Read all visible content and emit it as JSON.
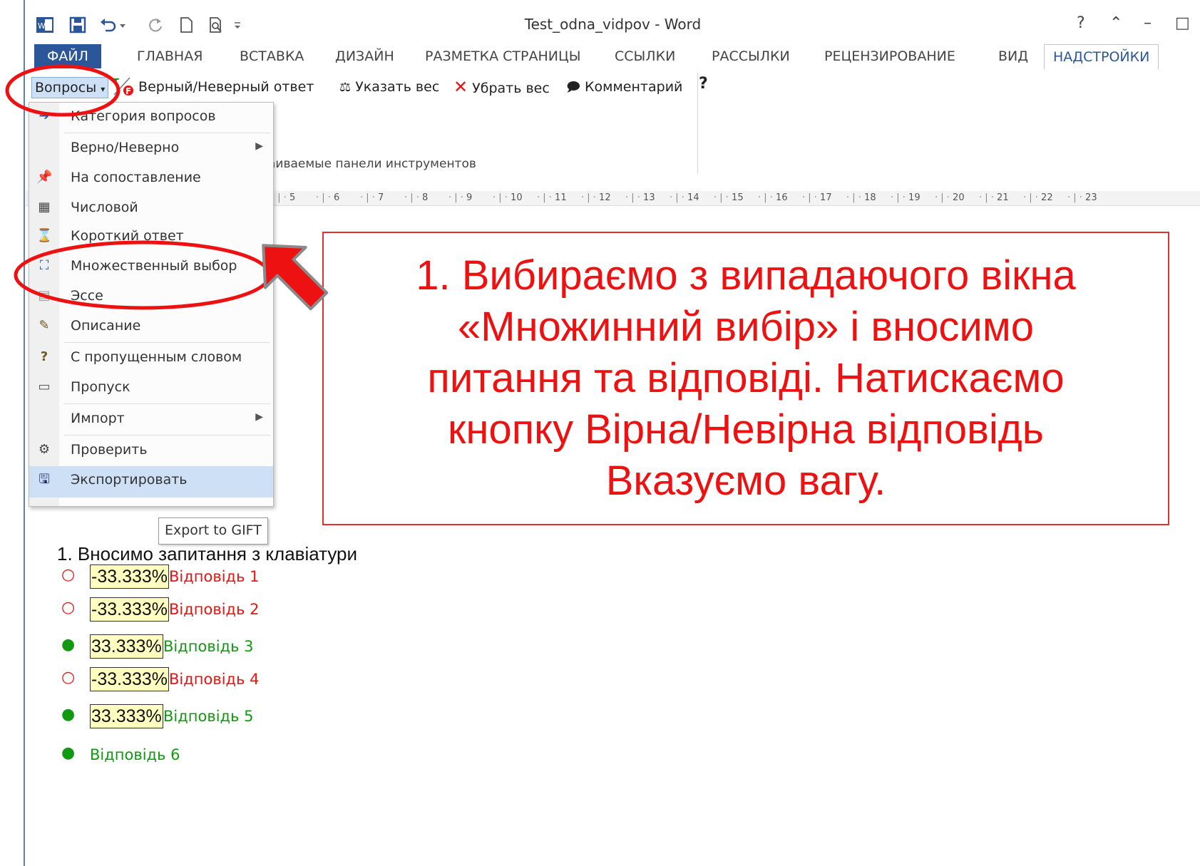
{
  "app": {
    "title": "Test_odna_vidpov - Word",
    "window_controls": [
      "?",
      "⌃",
      "–",
      "□"
    ]
  },
  "tabs": [
    {
      "label": "ФАЙЛ"
    },
    {
      "label": "ГЛАВНАЯ"
    },
    {
      "label": "ВСТАВКА"
    },
    {
      "label": "ДИЗАЙН"
    },
    {
      "label": "РАЗМЕТКА СТРАНИЦЫ"
    },
    {
      "label": "ССЫЛКИ"
    },
    {
      "label": "РАССЫЛКИ"
    },
    {
      "label": "РЕЦЕНЗИРОВАНИЕ"
    },
    {
      "label": "ВИД"
    },
    {
      "label": "НАДСТРОЙКИ"
    }
  ],
  "ribbon": {
    "questions_label": "Вопросы",
    "true_false_label": "Верный/Неверный ответ",
    "set_weight_label": "Указать вес",
    "remove_weight_label": "Убрать вес",
    "comment_label": "Комментарий",
    "help_glyph": "?",
    "group_label": "аиваемые панели инструментов"
  },
  "ruler": {
    "marks": [
      "5",
      "6",
      "7",
      "8",
      "9",
      "10",
      "11",
      "12",
      "13",
      "14",
      "15",
      "16",
      "17",
      "18",
      "19",
      "20",
      "21",
      "22",
      "23"
    ]
  },
  "dropdown": {
    "items": [
      {
        "label": "Категория вопросов"
      },
      {
        "label": "Верно/Неверно"
      },
      {
        "label": "На сопоставление"
      },
      {
        "label": "Числовой"
      },
      {
        "label": "Короткий ответ"
      },
      {
        "label": "Множественный выбор"
      },
      {
        "label": "Эссе"
      },
      {
        "label": "Описание"
      },
      {
        "label": "С пропущенным словом"
      },
      {
        "label": "Пропуск"
      },
      {
        "label": "Импорт"
      },
      {
        "label": "Проверить"
      },
      {
        "label": "Экспортировать"
      }
    ]
  },
  "tooltip": {
    "text": "Export to GIFT"
  },
  "callout": {
    "text": "1. Вибираємо  з випадаючого вікна\n«Множинний вибір» і вносимо\nпитання та відповіді. Натискаємо\nкнопку Вірна/Невірна відповідь\nВказуємо вагу."
  },
  "document": {
    "question": "1.  Вносимо запитання з клавіатури",
    "answers": [
      {
        "weight": "-33.333%",
        "text": "Відповідь 1",
        "correct": false
      },
      {
        "weight": "-33.333%",
        "text": "Відповідь 2",
        "correct": false
      },
      {
        "weight": "33.333%",
        "text": "Відповідь 3",
        "correct": true
      },
      {
        "weight": "-33.333%",
        "text": "Відповідь 4",
        "correct": false
      },
      {
        "weight": "33.333%",
        "text": "Відповідь 5",
        "correct": true
      },
      {
        "weight": "",
        "text": "Відповідь 6",
        "correct": true
      }
    ]
  },
  "colors": {
    "accent": "#2b579a",
    "highlight_red": "#e11",
    "correct_green": "#119911"
  }
}
